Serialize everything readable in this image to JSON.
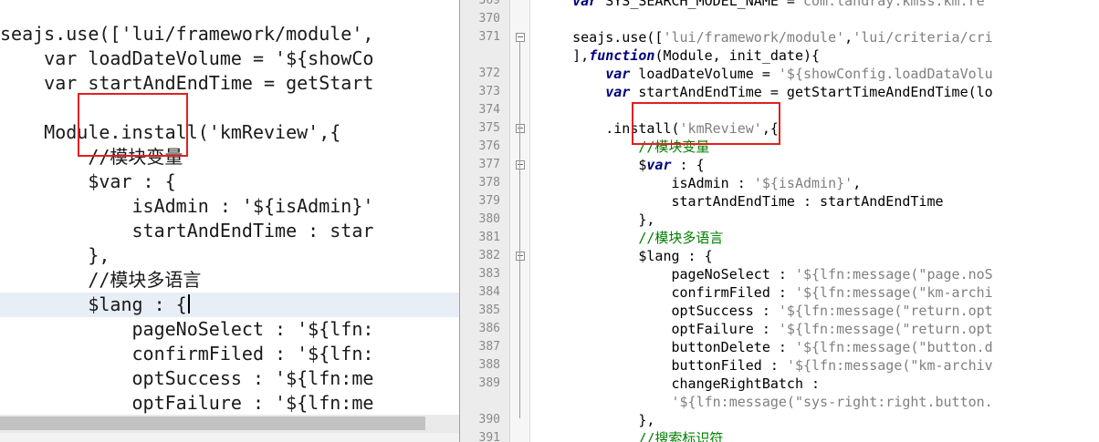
{
  "left_pane": {
    "lines": [
      {
        "text": "seajs.use(['lui/framework/module',"
      },
      {
        "text": "    var loadDateVolume = '${showCo"
      },
      {
        "text": "    var startAndEndTime = getStart"
      },
      {
        "text": ""
      },
      {
        "text": "    Module.install('kmReview',{"
      },
      {
        "text": "        //模块变量"
      },
      {
        "text": "        $var : {"
      },
      {
        "text": "            isAdmin : '${isAdmin}'"
      },
      {
        "text": "            startAndEndTime : star"
      },
      {
        "text": "        },"
      },
      {
        "text": "        //模块多语言"
      },
      {
        "text": "        $lang : {",
        "current": true
      },
      {
        "text": "            pageNoSelect : '${lfn:"
      },
      {
        "text": "            confirmFiled : '${lfn:"
      },
      {
        "text": "            optSuccess : '${lfn:me"
      },
      {
        "text": "            optFailure : '${lfn:me"
      }
    ]
  },
  "right_pane": {
    "lines": [
      {
        "num": "369",
        "fold": false,
        "spans": [
          {
            "c": "pl",
            "t": "    "
          },
          {
            "c": "kw",
            "t": "var"
          },
          {
            "c": "pl",
            "t": " SYS_SEARCH_MODEL_NAME ="
          },
          {
            "c": "str",
            "t": "\"com.landray.kmss.km.re"
          }
        ]
      },
      {
        "num": "370",
        "fold": false,
        "spans": []
      },
      {
        "num": "371",
        "fold": true,
        "spans": [
          {
            "c": "pl",
            "t": "    seajs.use(["
          },
          {
            "c": "str",
            "t": "'lui/framework/module'"
          },
          {
            "c": "pl",
            "t": ","
          },
          {
            "c": "str",
            "t": "'lui/criteria/cri"
          }
        ]
      },
      {
        "num": "",
        "fold": false,
        "spans": [
          {
            "c": "pl",
            "t": "    ],"
          },
          {
            "c": "kw",
            "t": "function"
          },
          {
            "c": "pl",
            "t": "(Module, init_date){"
          }
        ]
      },
      {
        "num": "372",
        "fold": false,
        "spans": [
          {
            "c": "pl",
            "t": "        "
          },
          {
            "c": "kw",
            "t": "var"
          },
          {
            "c": "pl",
            "t": " loadDateVolume = "
          },
          {
            "c": "str",
            "t": "'${showConfig.loadDataVolu"
          }
        ]
      },
      {
        "num": "373",
        "fold": false,
        "spans": [
          {
            "c": "pl",
            "t": "        "
          },
          {
            "c": "kw",
            "t": "var"
          },
          {
            "c": "pl",
            "t": " startAndEndTime = getStartTimeAndEndTime(lo"
          }
        ]
      },
      {
        "num": "374",
        "fold": false,
        "spans": []
      },
      {
        "num": "375",
        "fold": true,
        "spans": [
          {
            "c": "pl",
            "t": "        .install("
          },
          {
            "c": "str",
            "t": "'kmReview'"
          },
          {
            "c": "pl",
            "t": ",{"
          }
        ]
      },
      {
        "num": "376",
        "fold": false,
        "spans": [
          {
            "c": "pl",
            "t": "            "
          },
          {
            "c": "cmt",
            "t": "//模块变量"
          }
        ]
      },
      {
        "num": "377",
        "fold": true,
        "spans": [
          {
            "c": "pl",
            "t": "            $"
          },
          {
            "c": "kw",
            "t": "var"
          },
          {
            "c": "pl",
            "t": " : {"
          }
        ]
      },
      {
        "num": "378",
        "fold": false,
        "spans": [
          {
            "c": "pl",
            "t": "                isAdmin : "
          },
          {
            "c": "str",
            "t": "'${isAdmin}'"
          },
          {
            "c": "pl",
            "t": ","
          }
        ]
      },
      {
        "num": "379",
        "fold": false,
        "spans": [
          {
            "c": "pl",
            "t": "                startAndEndTime : startAndEndTime"
          }
        ]
      },
      {
        "num": "380",
        "fold": false,
        "spans": [
          {
            "c": "pl",
            "t": "            },"
          }
        ]
      },
      {
        "num": "381",
        "fold": false,
        "spans": [
          {
            "c": "pl",
            "t": "            "
          },
          {
            "c": "cmt",
            "t": "//模块多语言"
          }
        ]
      },
      {
        "num": "382",
        "fold": true,
        "spans": [
          {
            "c": "pl",
            "t": "            $lang : {"
          }
        ]
      },
      {
        "num": "383",
        "fold": false,
        "spans": [
          {
            "c": "pl",
            "t": "                pageNoSelect : "
          },
          {
            "c": "str",
            "t": "'${lfn:message(\"page.noS"
          }
        ]
      },
      {
        "num": "384",
        "fold": false,
        "spans": [
          {
            "c": "pl",
            "t": "                confirmFiled : "
          },
          {
            "c": "str",
            "t": "'${lfn:message(\"km-archi"
          }
        ]
      },
      {
        "num": "385",
        "fold": false,
        "spans": [
          {
            "c": "pl",
            "t": "                optSuccess : "
          },
          {
            "c": "str",
            "t": "'${lfn:message(\"return.opt"
          }
        ]
      },
      {
        "num": "386",
        "fold": false,
        "spans": [
          {
            "c": "pl",
            "t": "                optFailure : "
          },
          {
            "c": "str",
            "t": "'${lfn:message(\"return.opt"
          }
        ]
      },
      {
        "num": "387",
        "fold": false,
        "spans": [
          {
            "c": "pl",
            "t": "                buttonDelete : "
          },
          {
            "c": "str",
            "t": "'${lfn:message(\"button.d"
          }
        ]
      },
      {
        "num": "388",
        "fold": false,
        "spans": [
          {
            "c": "pl",
            "t": "                buttonFiled : "
          },
          {
            "c": "str",
            "t": "'${lfn:message(\"km-archiv"
          }
        ]
      },
      {
        "num": "389",
        "fold": false,
        "spans": [
          {
            "c": "pl",
            "t": "                changeRightBatch :"
          }
        ]
      },
      {
        "num": "",
        "fold": false,
        "spans": [
          {
            "c": "pl",
            "t": "                "
          },
          {
            "c": "str",
            "t": "'${lfn:message(\"sys-right:right.button."
          }
        ]
      },
      {
        "num": "390",
        "fold": false,
        "spans": [
          {
            "c": "pl",
            "t": "            },"
          }
        ]
      },
      {
        "num": "391",
        "fold": false,
        "spans": [
          {
            "c": "pl",
            "t": "            "
          },
          {
            "c": "cmt",
            "t": "//搜索标识符"
          }
        ]
      }
    ]
  },
  "colors": {
    "annotation_red": "#e02020",
    "keyword": "#00007f",
    "string": "#808080",
    "comment": "#007f00",
    "current_line": "#e8eef6"
  }
}
